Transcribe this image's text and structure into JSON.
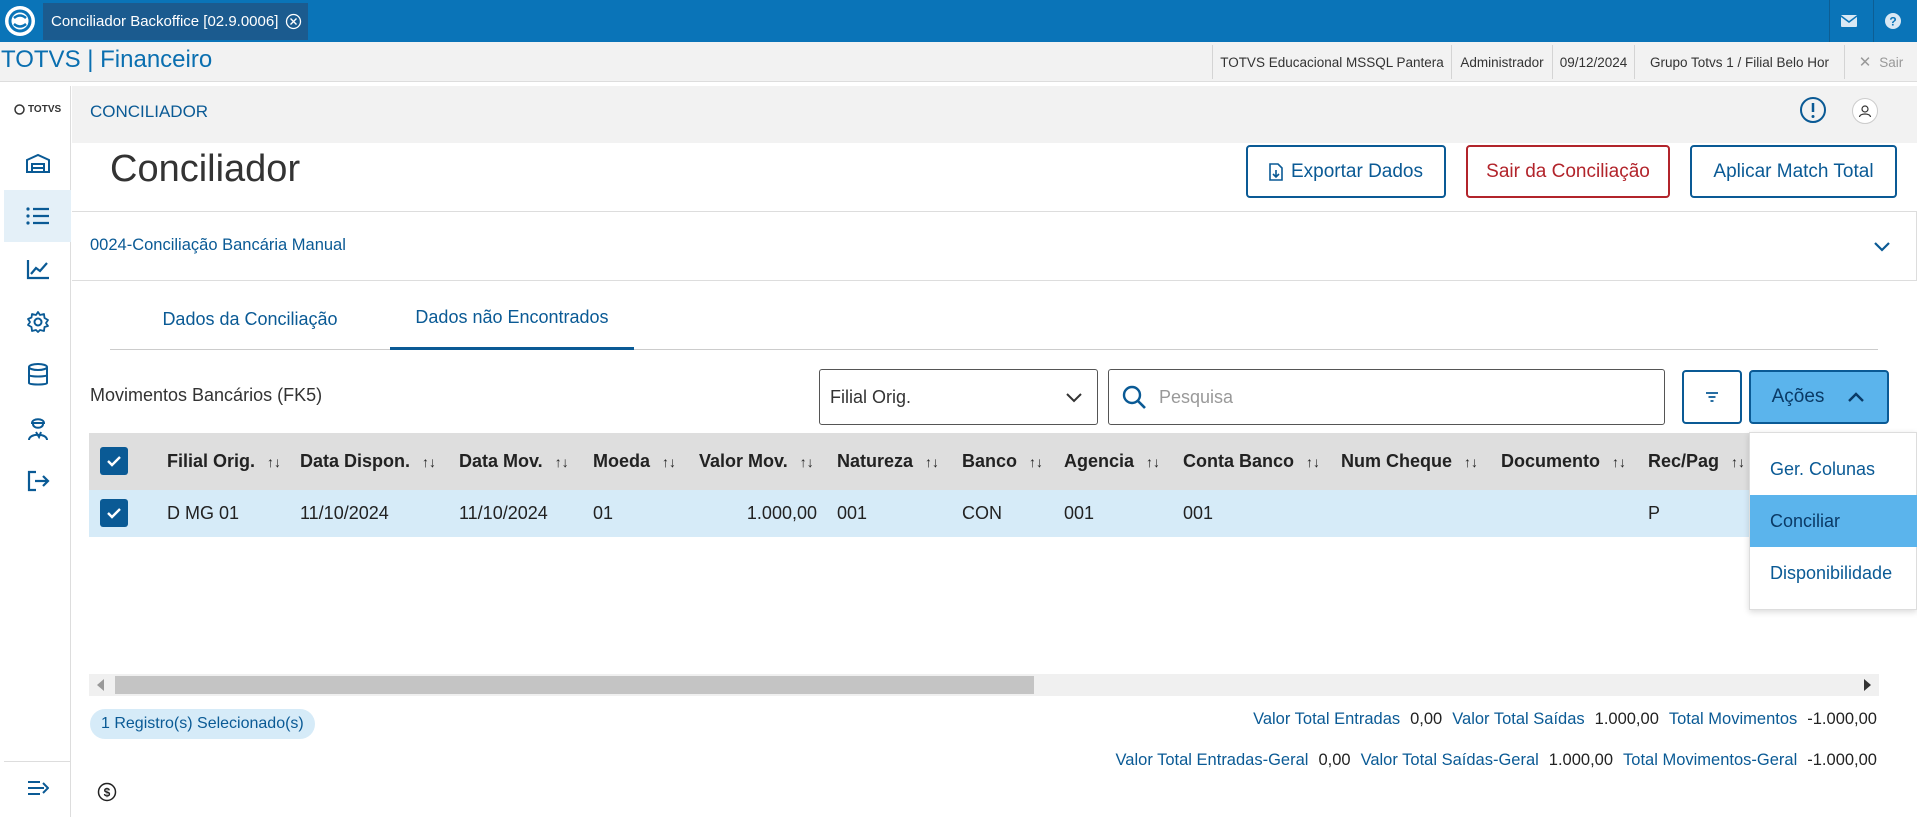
{
  "titlebar": {
    "tab_label": "Conciliador Backoffice [02.9.0006]"
  },
  "menubar": {
    "brand": "TOTVS | Financeiro",
    "environment": "TOTVS Educacional MSSQL Pantera",
    "user": "Administrador",
    "date": "09/12/2024",
    "branch": "Grupo Totvs 1 / Filial Belo Hor",
    "exit": "Sair"
  },
  "sidebar": {
    "logo_text": "TOTVS"
  },
  "header": {
    "section": "CONCILIADOR"
  },
  "page": {
    "title": "Conciliador",
    "buttons": {
      "export": "Exportar Dados",
      "exit": "Sair da Conciliação",
      "match": "Aplicar Match Total"
    }
  },
  "accordion": {
    "title": "0024-Conciliação Bancária Manual"
  },
  "tabs": [
    {
      "label": "Dados da Conciliação",
      "active": false
    },
    {
      "label": "Dados não Encontrados",
      "active": true
    }
  ],
  "grid": {
    "title": "Movimentos Bancários (FK5)",
    "filter_select": "Filial Orig.",
    "search_placeholder": "Pesquisa",
    "actions_label": "Ações",
    "columns": [
      "Filial Orig.",
      "Data Dispon.",
      "Data Mov.",
      "Moeda",
      "Valor Mov.",
      "Natureza",
      "Banco",
      "Agencia",
      "Conta Banco",
      "Num Cheque",
      "Documento",
      "Rec/Pag"
    ],
    "rows": [
      [
        "D MG 01",
        "11/10/2024",
        "11/10/2024",
        "01",
        "1.000,00",
        "001",
        "CON",
        "001",
        "001",
        "",
        "",
        "P"
      ]
    ]
  },
  "actions_menu": [
    {
      "label": "Ger. Colunas",
      "active": false
    },
    {
      "label": "Conciliar",
      "active": true
    },
    {
      "label": "Disponibilidade",
      "active": false
    }
  ],
  "footer": {
    "selected": "1 Registro(s) Selecionado(s)",
    "totals": [
      {
        "label": "Valor Total Entradas",
        "value": "0,00"
      },
      {
        "label": "Valor Total Saídas",
        "value": "1.000,00"
      },
      {
        "label": "Total Movimentos",
        "value": "-1.000,00"
      }
    ],
    "totals_general": [
      {
        "label": "Valor Total Entradas-Geral",
        "value": "0,00"
      },
      {
        "label": "Valor Total Saídas-Geral",
        "value": "1.000,00"
      },
      {
        "label": "Total Movimentos-Geral",
        "value": "-1.000,00"
      }
    ]
  },
  "colors": {
    "primary": "#0a5a95",
    "titlebar": "#0a74b8",
    "danger": "#b2242b",
    "row_selected": "#d6ebf8",
    "action_active": "#5bb4ec"
  }
}
